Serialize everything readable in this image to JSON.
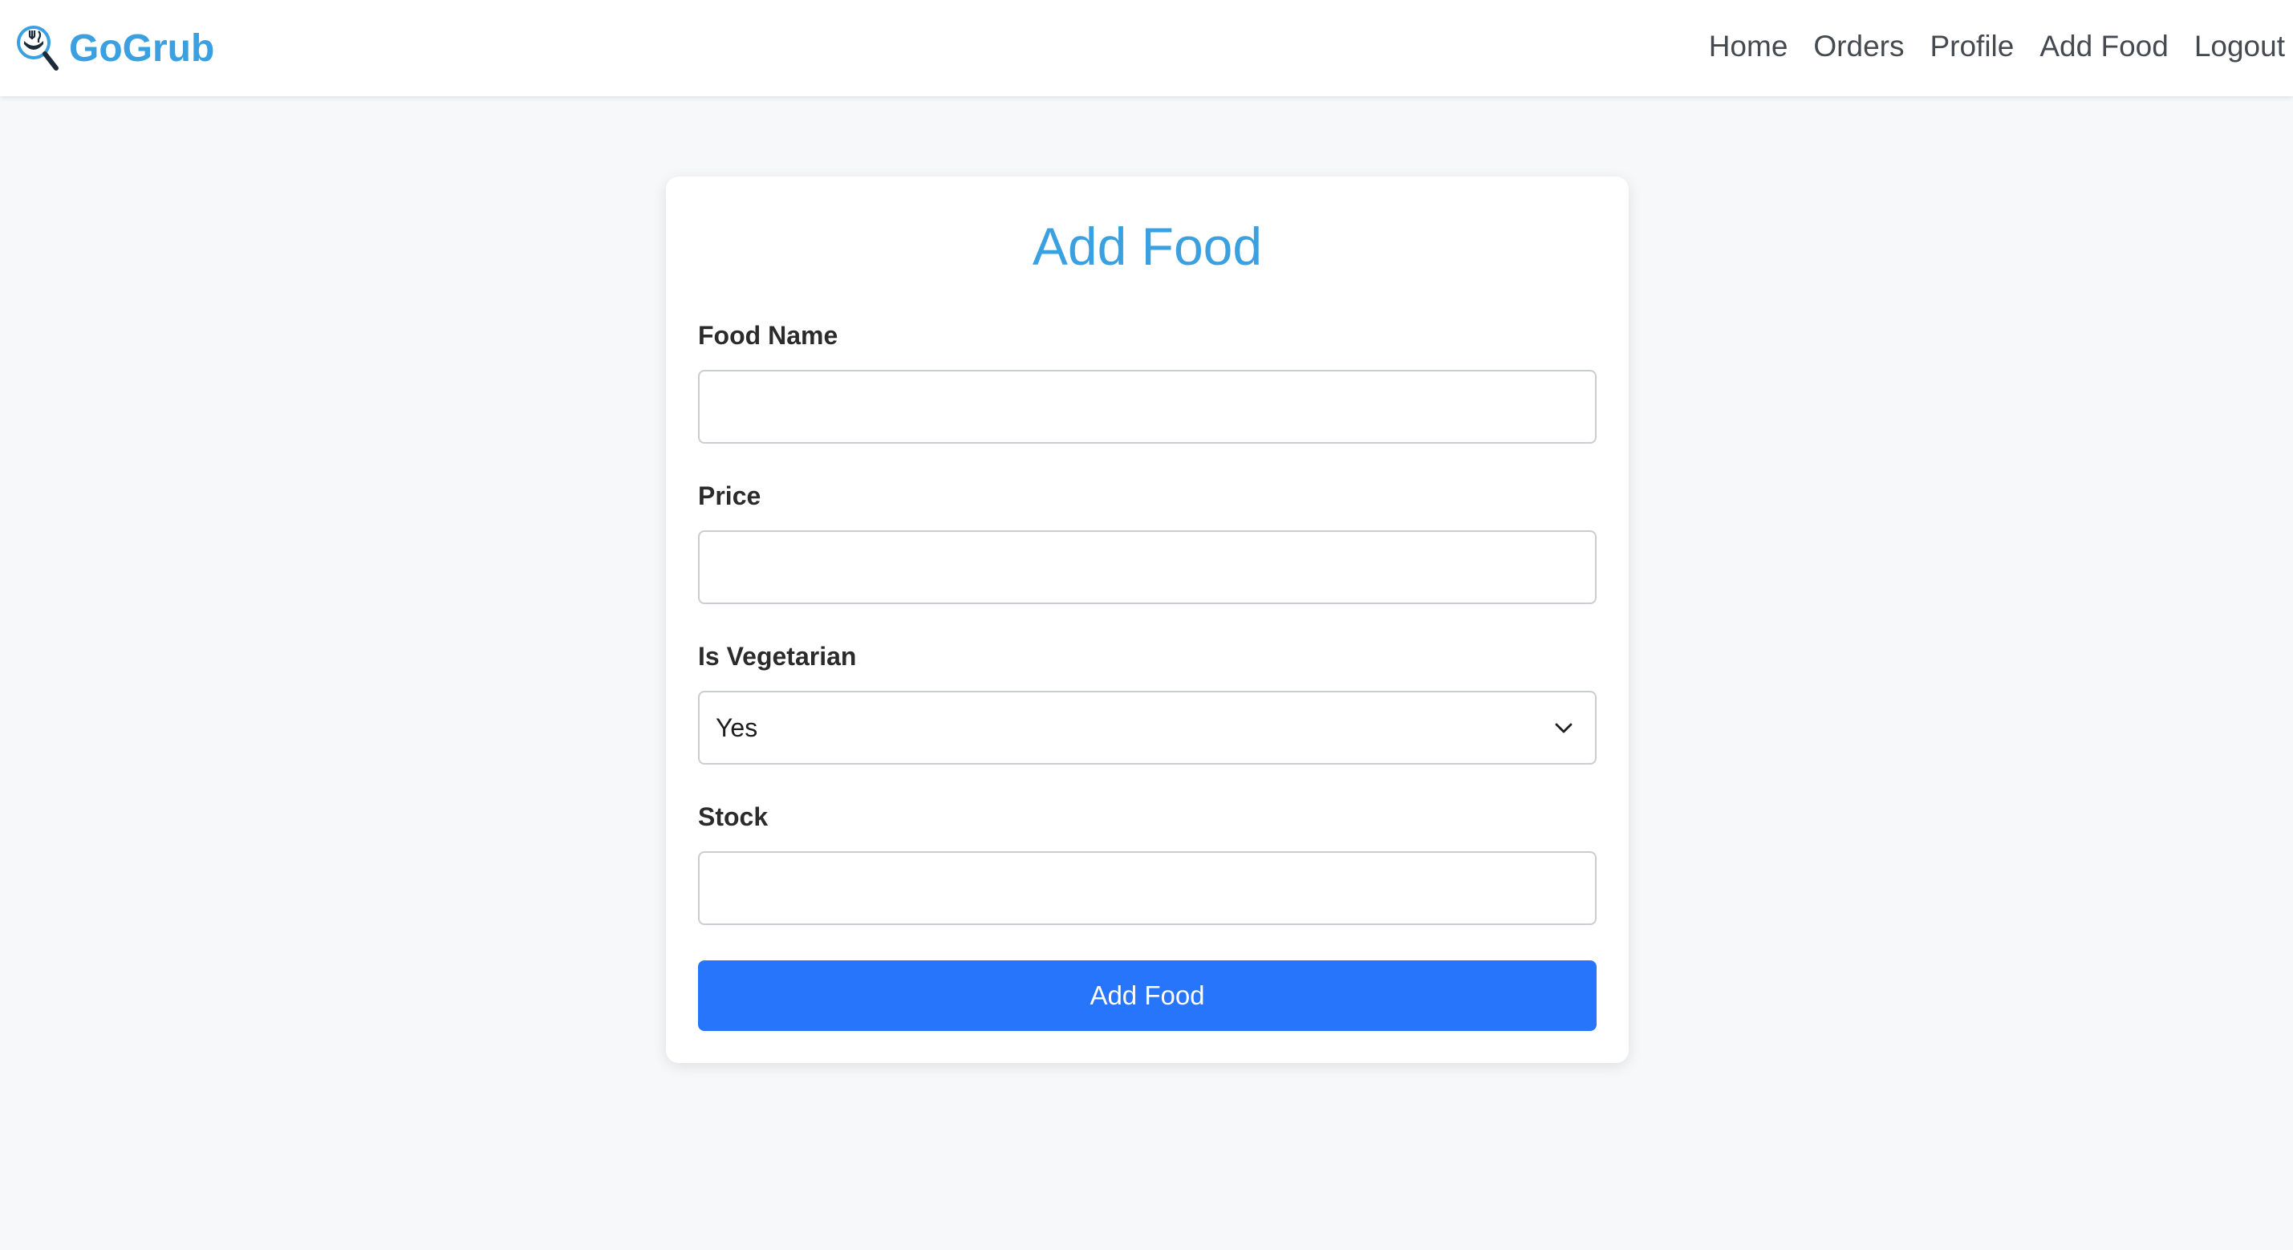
{
  "brand": {
    "name": "GoGrub",
    "logo_icon": "food-search-logo-icon",
    "color": "#3aa0e0"
  },
  "nav": {
    "items": [
      {
        "label": "Home"
      },
      {
        "label": "Orders"
      },
      {
        "label": "Profile"
      },
      {
        "label": "Add Food"
      },
      {
        "label": "Logout"
      }
    ]
  },
  "form": {
    "title": "Add Food",
    "fields": {
      "food_name": {
        "label": "Food Name",
        "value": ""
      },
      "price": {
        "label": "Price",
        "value": ""
      },
      "is_vegetarian": {
        "label": "Is Vegetarian",
        "selected": "Yes",
        "icon": "chevron-down-icon"
      },
      "stock": {
        "label": "Stock",
        "value": ""
      }
    },
    "submit_label": "Add Food",
    "submit_color": "#2775fb"
  }
}
